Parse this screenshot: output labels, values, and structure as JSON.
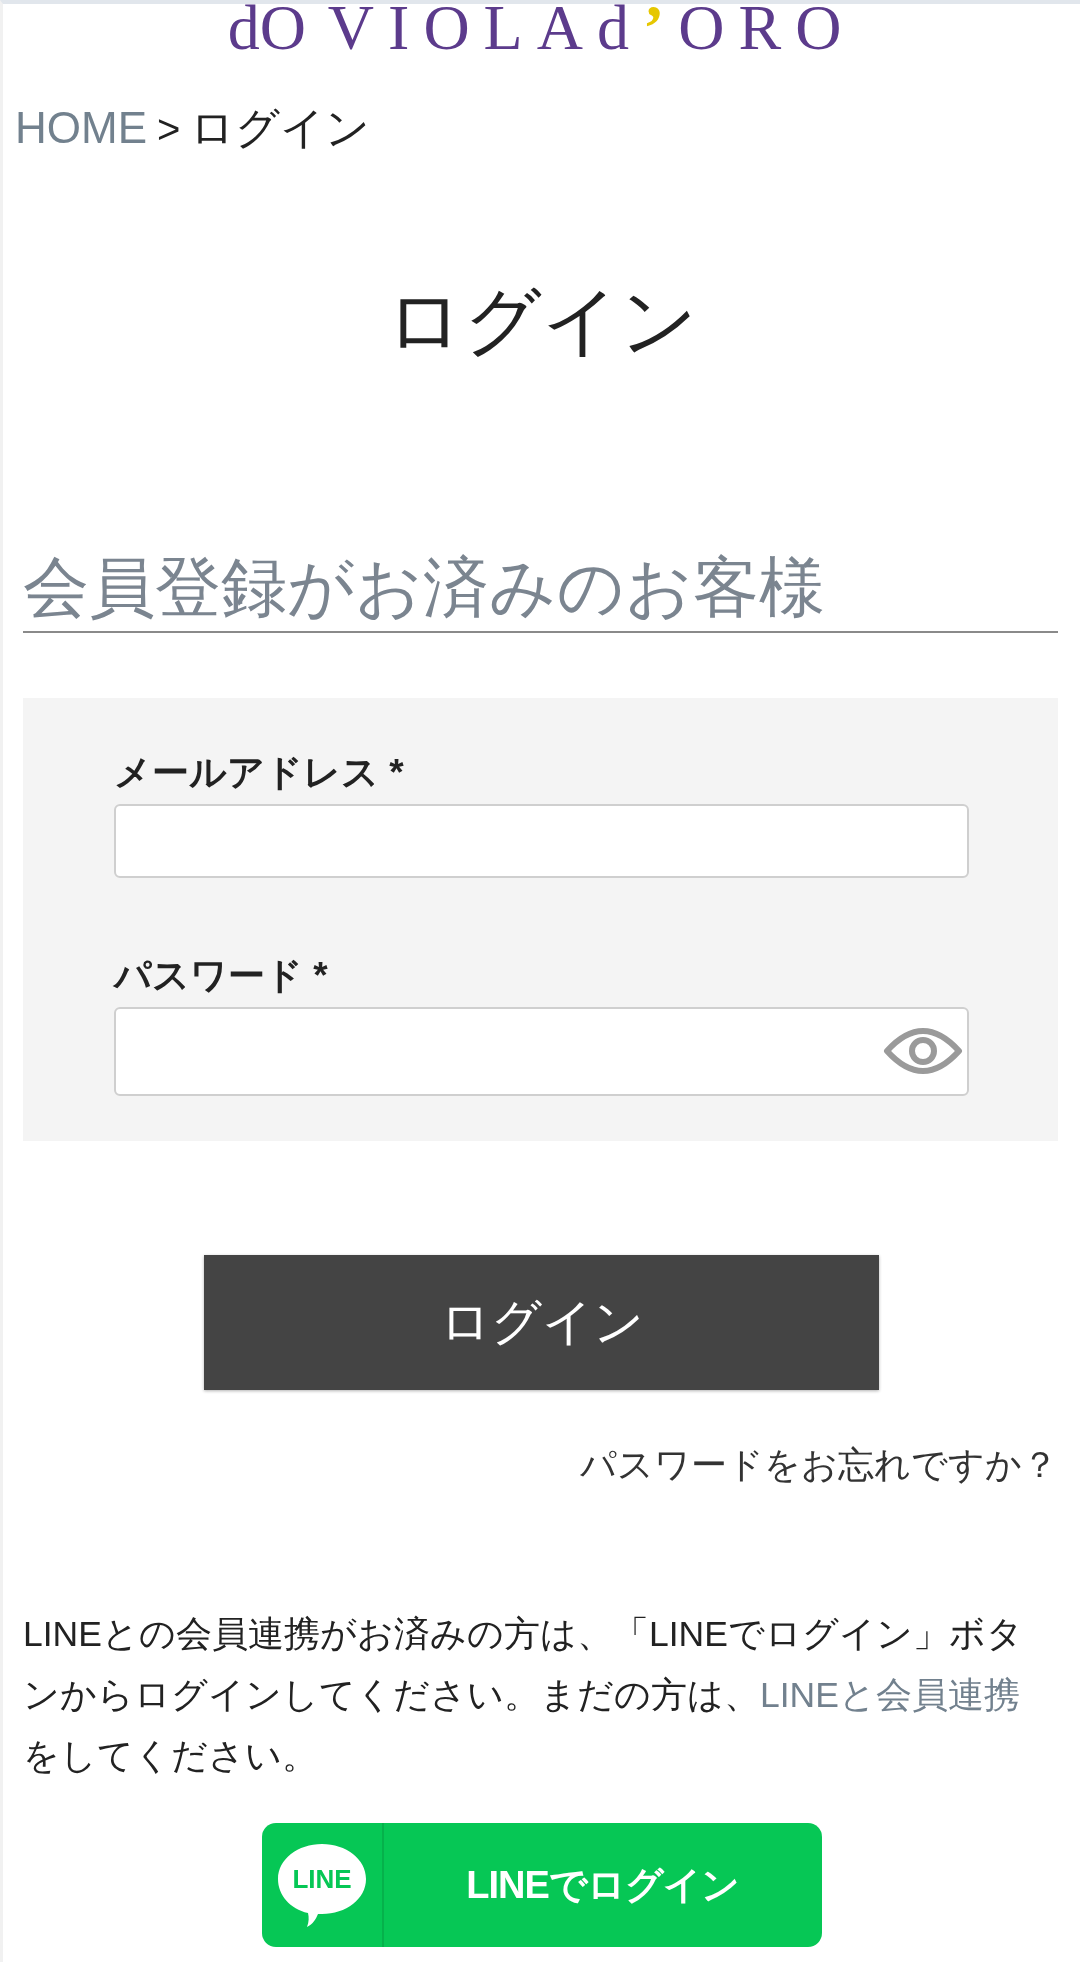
{
  "header": {
    "logo": {
      "monogram": "dO",
      "wordmark": "VIOLAd**’**ORO"
    }
  },
  "breadcrumb": [
    {
      "label": "HOME",
      "kind": "link"
    },
    {
      "label": ">",
      "kind": "separator"
    },
    {
      "label": "ログイン",
      "kind": "current"
    }
  ],
  "page_title": "ログイン",
  "section_heading": "会員登録がお済みのお客様",
  "login_form": {
    "fields": [
      {
        "label": "メールアドレス *",
        "kind": "email"
      },
      {
        "label": "パスワード *",
        "kind": "password"
      }
    ],
    "submit_button": "ログイン",
    "forgot_link": "パスワードをお忘れですか？"
  },
  "line_notice": {
    "text_before": "LINEとの会員連携がお済みの方は、「LINEでログイン」ボタンからログインしてください。まだの方は、",
    "link": "LINEと会員連携",
    "text_after": "をしてください。"
  },
  "line_button": {
    "logo_text": "LINE",
    "label": "LINEでログイン"
  }
}
